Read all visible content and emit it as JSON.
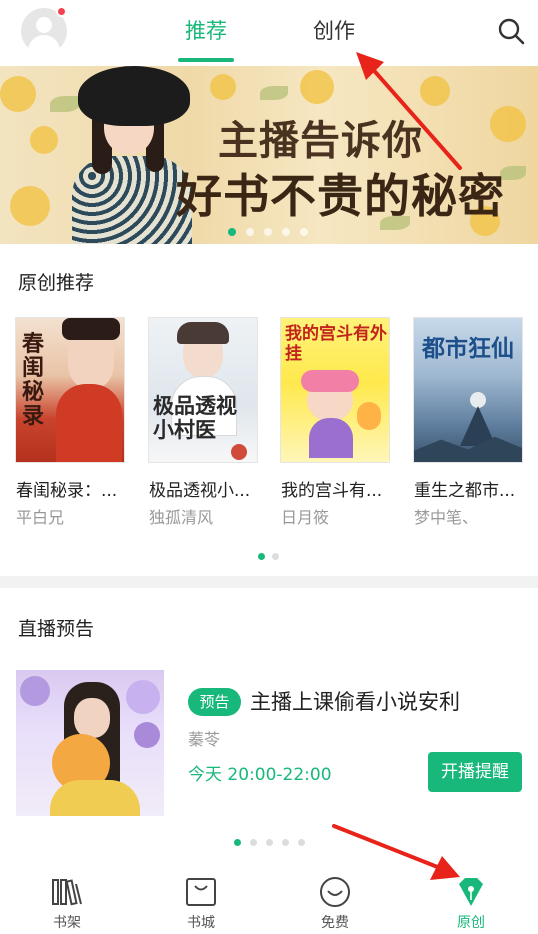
{
  "header": {
    "tabs": [
      {
        "label": "推荐",
        "active": true
      },
      {
        "label": "创作",
        "active": false
      }
    ],
    "avatar_has_notification": true,
    "search_icon": "search-icon"
  },
  "banner": {
    "line1": "主播告诉你",
    "line2": "好书不贵的秘密",
    "dots_total": 5,
    "dots_active_index": 0
  },
  "original_recommend": {
    "title": "原创推荐",
    "books": [
      {
        "title": "春闺秘录：...",
        "author": "平白兄",
        "cover_text": "春闺秘录"
      },
      {
        "title": "极品透视小...",
        "author": "独孤清风",
        "cover_text": "极品透视小村医"
      },
      {
        "title": "我的宫斗有...",
        "author": "日月筱",
        "cover_text": "我的宫斗有外挂"
      },
      {
        "title": "重生之都市...",
        "author": "梦中笔、",
        "cover_text": "都市狂仙"
      }
    ],
    "dots_total": 2,
    "dots_active_index": 0
  },
  "live_preview": {
    "title": "直播预告",
    "badge": "预告",
    "show_title": "主播上课偷看小说安利",
    "host": "蓁苓",
    "time": "今天 20:00-22:00",
    "remind_button": "开播提醒",
    "dots_total": 5,
    "dots_active_index": 0
  },
  "bottom_nav": {
    "items": [
      {
        "label": "书架",
        "icon": "bookshelf-icon",
        "active": false
      },
      {
        "label": "书城",
        "icon": "bookstore-bag-icon",
        "active": false
      },
      {
        "label": "免费",
        "icon": "smiley-icon",
        "active": false
      },
      {
        "label": "原创",
        "icon": "gem-pen-icon",
        "active": true
      }
    ]
  },
  "colors": {
    "accent": "#18b87a",
    "annotation_arrow": "#e8231a",
    "notification_dot": "#f3424f"
  }
}
